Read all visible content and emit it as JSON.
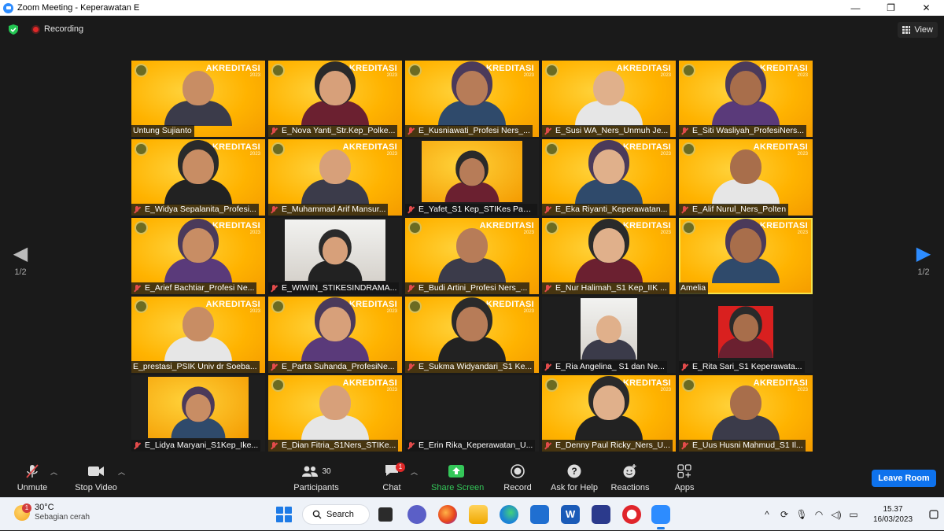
{
  "window": {
    "title": "Zoom Meeting - Keperawatan E",
    "controls": [
      "—",
      "❐",
      "✕"
    ]
  },
  "meeting": {
    "recording_label": "Recording",
    "view_label": "View",
    "page_indicator_left": "1/2",
    "page_indicator_right": "1/2",
    "banner_title": "AKREDITASI",
    "banner_year": "2023"
  },
  "participants": [
    {
      "name": "Untung Sujianto",
      "muted": false,
      "bg": "yellow"
    },
    {
      "name": "E_Nova Yanti_Str.Kep_Polke...",
      "muted": true,
      "bg": "yellow"
    },
    {
      "name": "E_Kusniawati_Profesi Ners_...",
      "muted": true,
      "bg": "yellow"
    },
    {
      "name": "E_Susi WA_Ners_Unmuh Je...",
      "muted": true,
      "bg": "yellow"
    },
    {
      "name": "E_Siti Wasliyah_ProfesiNers...",
      "muted": true,
      "bg": "yellow"
    },
    {
      "name": "E_Widya Sepalanita_Profesi...",
      "muted": true,
      "bg": "yellow"
    },
    {
      "name": "E_Muhammad Arif Mansur...",
      "muted": true,
      "bg": "yellow"
    },
    {
      "name": "E_Yafet_S1 Kep_STIKes Pant...",
      "muted": true,
      "bg": "inset-yellow"
    },
    {
      "name": "E_Eka Riyanti_Keperawatan...",
      "muted": true,
      "bg": "yellow"
    },
    {
      "name": "E_Alif Nurul_Ners_Polten",
      "muted": true,
      "bg": "yellow"
    },
    {
      "name": "E_Arief Bachtiar_Profesi Ne...",
      "muted": true,
      "bg": "yellow"
    },
    {
      "name": "E_WIWIN_STIKESINDRAMA...",
      "muted": true,
      "bg": "inset-white"
    },
    {
      "name": "E_Budi Artini_Profesi Ners_...",
      "muted": true,
      "bg": "yellow"
    },
    {
      "name": "E_Nur Halimah_S1 Kep_IIK ...",
      "muted": true,
      "bg": "yellow"
    },
    {
      "name": "Amelia",
      "muted": false,
      "bg": "yellow",
      "active": true
    },
    {
      "name": "E_prestasi_PSIK Univ dr Soeba...",
      "muted": false,
      "bg": "yellow"
    },
    {
      "name": "E_Parta Suhanda_ProfesiNe...",
      "muted": true,
      "bg": "yellow"
    },
    {
      "name": "E_Sukma Widyandari_S1 Ke...",
      "muted": true,
      "bg": "yellow"
    },
    {
      "name": "E_Ria Angelina_ S1 dan Ne...",
      "muted": true,
      "bg": "inset-white"
    },
    {
      "name": "E_Rita Sari_S1 Keperawata...",
      "muted": true,
      "bg": "inset-red"
    },
    {
      "name": "E_Lidya Maryani_S1Kep_Ike...",
      "muted": true,
      "bg": "inset-yellow"
    },
    {
      "name": "E_Dian Fitria_S1Ners_STIKe...",
      "muted": true,
      "bg": "yellow"
    },
    {
      "name": "E_Erin Rika_Keperawatan_U...",
      "muted": true,
      "bg": "dark"
    },
    {
      "name": "E_Denny Paul Ricky_Ners_U...",
      "muted": true,
      "bg": "yellow"
    },
    {
      "name": "E_Uus Husni Mahmud_S1 Il...",
      "muted": true,
      "bg": "yellow"
    }
  ],
  "toolbar": {
    "unmute": "Unmute",
    "stop_video": "Stop Video",
    "participants": "Participants",
    "participants_count": "30",
    "chat": "Chat",
    "chat_badge": "1",
    "share_screen": "Share Screen",
    "record": "Record",
    "ask_for_help": "Ask for Help",
    "reactions": "Reactions",
    "apps": "Apps",
    "leave": "Leave Room"
  },
  "taskbar": {
    "weather_badge": "1",
    "temperature": "30°C",
    "condition": "Sebagian cerah",
    "search": "Search",
    "time": "15.37",
    "date": "16/03/2023"
  },
  "colors": {
    "accent": "#0e72ed",
    "share_green": "#34c759",
    "tile_yellow": "#ffb300",
    "active_outline": "#f5e34a"
  }
}
